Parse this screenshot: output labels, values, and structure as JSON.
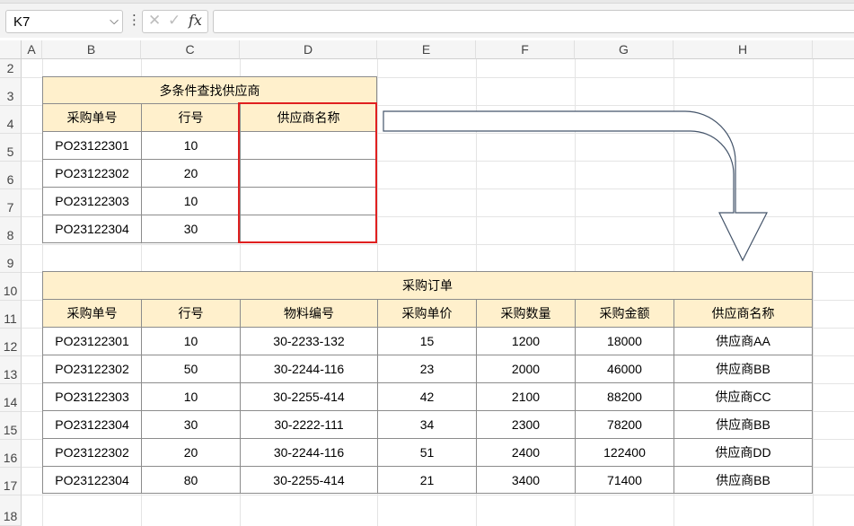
{
  "formula_bar": {
    "name_box": "K7",
    "fx_label": "fx",
    "formula": ""
  },
  "columns": [
    "A",
    "B",
    "C",
    "D",
    "E",
    "F",
    "G",
    "H"
  ],
  "rows": [
    "2",
    "3",
    "4",
    "5",
    "6",
    "7",
    "8",
    "9",
    "10",
    "11",
    "12",
    "13",
    "14",
    "15",
    "16",
    "17",
    "18"
  ],
  "lookup_table": {
    "title": "多条件查找供应商",
    "headers": [
      "采购单号",
      "行号",
      "供应商名称"
    ],
    "rows": [
      [
        "PO23122301",
        "10",
        ""
      ],
      [
        "PO23122302",
        "20",
        ""
      ],
      [
        "PO23122303",
        "10",
        ""
      ],
      [
        "PO23122304",
        "30",
        ""
      ]
    ]
  },
  "order_table": {
    "title": "采购订单",
    "headers": [
      "采购单号",
      "行号",
      "物料编号",
      "采购单价",
      "采购数量",
      "采购金额",
      "供应商名称"
    ],
    "rows": [
      [
        "PO23122301",
        "10",
        "30-2233-132",
        "15",
        "1200",
        "18000",
        "供应商AA"
      ],
      [
        "PO23122302",
        "50",
        "30-2244-116",
        "23",
        "2000",
        "46000",
        "供应商BB"
      ],
      [
        "PO23122303",
        "10",
        "30-2255-414",
        "42",
        "2100",
        "88200",
        "供应商CC"
      ],
      [
        "PO23122304",
        "30",
        "30-2222-111",
        "34",
        "2300",
        "78200",
        "供应商BB"
      ],
      [
        "PO23122302",
        "20",
        "30-2244-116",
        "51",
        "2400",
        "122400",
        "供应商DD"
      ],
      [
        "PO23122304",
        "80",
        "30-2255-414",
        "21",
        "3400",
        "71400",
        "供应商BB"
      ]
    ]
  },
  "colors": {
    "header_fill": "#fff0cc",
    "highlight_border": "#e02020",
    "arrow_stroke": "#44546a"
  },
  "icons": [
    "dropdown-arrow-icon",
    "more-icon",
    "cancel-icon",
    "enter-icon",
    "fx-icon",
    "bent-arrow-icon"
  ]
}
